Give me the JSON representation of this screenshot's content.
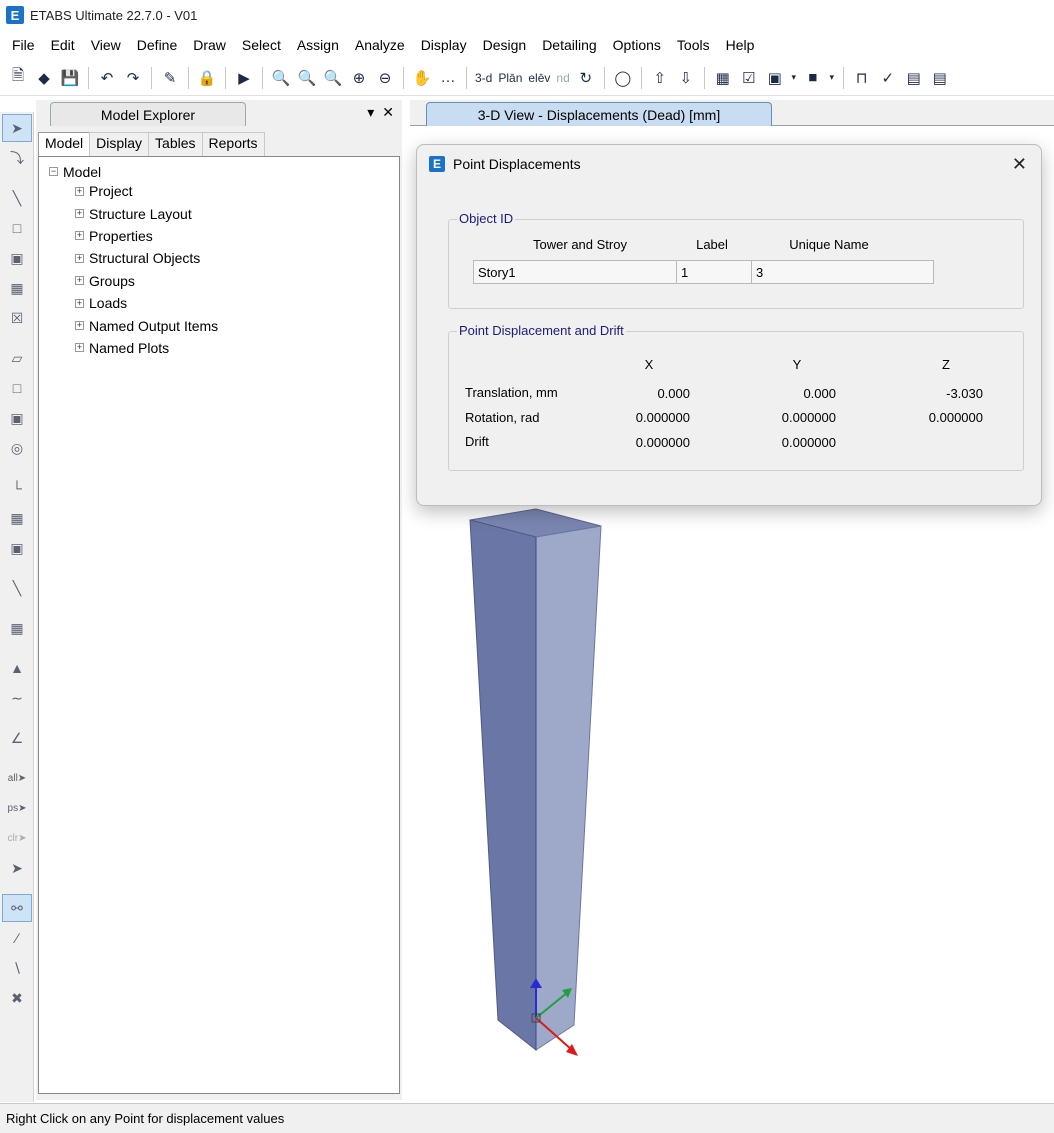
{
  "app": {
    "logo_letter": "E",
    "title": "ETABS Ultimate 22.7.0 - V01"
  },
  "menu": [
    "File",
    "Edit",
    "View",
    "Define",
    "Draw",
    "Select",
    "Assign",
    "Analyze",
    "Display",
    "Design",
    "Detailing",
    "Options",
    "Tools",
    "Help"
  ],
  "toolbar": {
    "btn_3d": "3-d",
    "btn_plan": "Plān",
    "btn_elev": "elēv",
    "btn_nd": "nd"
  },
  "explorer": {
    "header": "Model Explorer",
    "tabs": [
      "Model",
      "Display",
      "Tables",
      "Reports"
    ],
    "tree_root": "Model",
    "tree_items": [
      "Project",
      "Structure Layout",
      "Properties",
      "Structural Objects",
      "Groups",
      "Loads",
      "Named Output Items",
      "Named Plots"
    ]
  },
  "view": {
    "tab_label": "3-D View  - Displacements (Dead)  [mm]"
  },
  "dialog": {
    "title": "Point Displacements",
    "object_id": {
      "group_title": "Object ID",
      "headers": [
        "Tower and Stroy",
        "Label",
        "Unique Name"
      ],
      "values": [
        "Story1",
        "1",
        "3"
      ]
    },
    "displacement": {
      "group_title": "Point Displacement and Drift",
      "col_headers": [
        "X",
        "Y",
        "Z"
      ],
      "rows": [
        {
          "label": "Translation, mm",
          "x": "0.000",
          "y": "0.000",
          "z": "-3.030"
        },
        {
          "label": "Rotation, rad",
          "x": "0.000000",
          "y": "0.000000",
          "z": "0.000000"
        },
        {
          "label": "Drift",
          "x": "0.000000",
          "y": "0.000000",
          "z": ""
        }
      ]
    }
  },
  "statusbar": {
    "text": "Right Click on any Point for displacement values"
  },
  "colors": {
    "column_front": "#6a77a6",
    "column_side": "#9aa4c6",
    "accent": "#1a73c8"
  }
}
